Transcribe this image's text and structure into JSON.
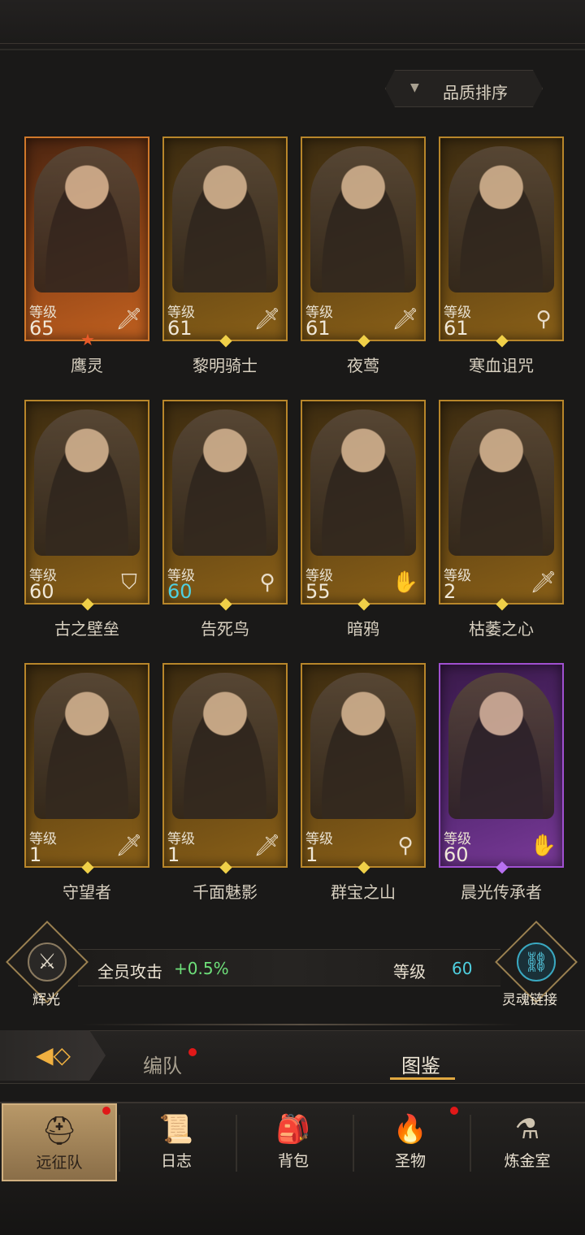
{
  "sort": {
    "label": "品质排序",
    "icon": "triangle-down-icon"
  },
  "heroes": [
    {
      "name": "鹰灵",
      "level_label": "等级",
      "level": "65",
      "class_icon": "sword-icon",
      "rarity": "orange"
    },
    {
      "name": "黎明骑士",
      "level_label": "等级",
      "level": "61",
      "class_icon": "sword-icon",
      "rarity": "gold"
    },
    {
      "name": "夜莺",
      "level_label": "等级",
      "level": "61",
      "class_icon": "sword-icon",
      "rarity": "gold"
    },
    {
      "name": "寒血诅咒",
      "level_label": "等级",
      "level": "61",
      "class_icon": "staff-icon",
      "rarity": "gold"
    },
    {
      "name": "古之壁垒",
      "level_label": "等级",
      "level": "60",
      "class_icon": "shield-icon",
      "rarity": "gold"
    },
    {
      "name": "告死鸟",
      "level_label": "等级",
      "level": "60",
      "class_icon": "staff-icon",
      "rarity": "gold"
    },
    {
      "name": "暗鸦",
      "level_label": "等级",
      "level": "55",
      "class_icon": "hand-icon",
      "rarity": "gold"
    },
    {
      "name": "枯萎之心",
      "level_label": "等级",
      "level": "2",
      "class_icon": "sword-icon",
      "rarity": "gold"
    },
    {
      "name": "守望者",
      "level_label": "等级",
      "level": "1",
      "class_icon": "sword-icon",
      "rarity": "gold"
    },
    {
      "name": "千面魅影",
      "level_label": "等级",
      "level": "1",
      "class_icon": "sword-icon",
      "rarity": "gold"
    },
    {
      "name": "群宝之山",
      "level_label": "等级",
      "level": "1",
      "class_icon": "staff-icon",
      "rarity": "gold"
    },
    {
      "name": "晨光传承者",
      "level_label": "等级",
      "level": "60",
      "class_icon": "hand-icon",
      "rarity": "purple"
    }
  ],
  "glory": {
    "label": "辉光",
    "icon": "sword-emblem-icon"
  },
  "bonus": {
    "text": "全员攻击",
    "value": "+0.5%"
  },
  "soul_link": {
    "level_label": "等级",
    "level": "60",
    "label": "灵魂链接",
    "icon": "link-icon"
  },
  "tabs": {
    "formation": "编队",
    "gallery": "图鉴"
  },
  "nav": [
    {
      "label": "远征队",
      "icon": "viking-helmet-icon",
      "active": true
    },
    {
      "label": "日志",
      "icon": "scroll-icon"
    },
    {
      "label": "背包",
      "icon": "bag-icon"
    },
    {
      "label": "圣物",
      "icon": "torch-icon"
    },
    {
      "label": "炼金室",
      "icon": "alchemy-icon"
    }
  ],
  "colors": {
    "gold_frame": "#b8862a",
    "orange_frame": "#d0782a",
    "purple_frame": "#a050d0",
    "cyan": "#4fd0e0",
    "green": "#6ee07a",
    "red_dot": "#e01818"
  }
}
